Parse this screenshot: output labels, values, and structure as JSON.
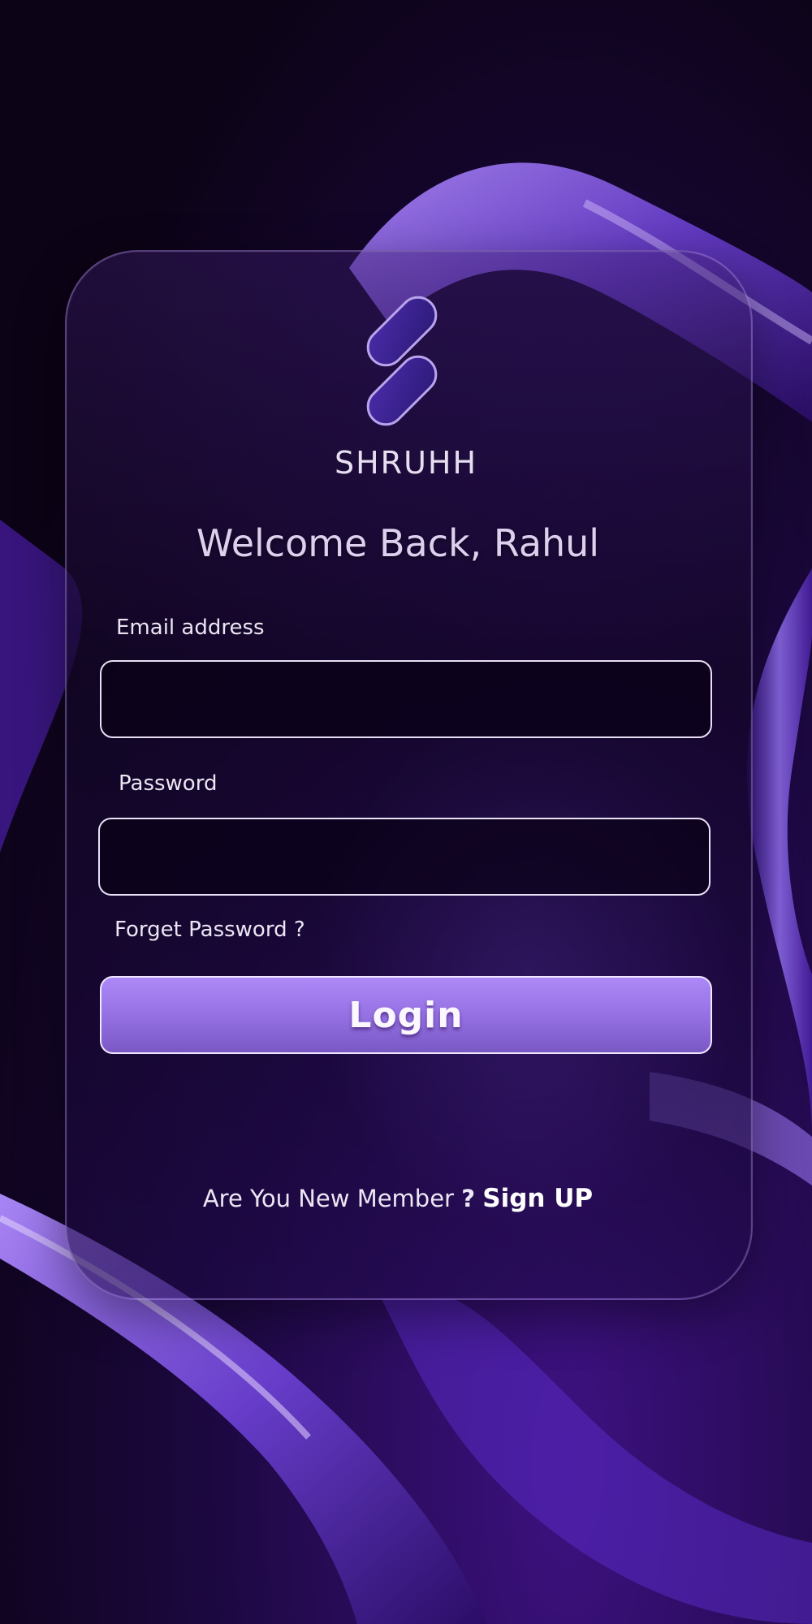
{
  "brand": {
    "name": "SHRUHH",
    "logo_icon": "brand-logo-icon"
  },
  "header": {
    "welcome_text": "Welcome Back, Rahul"
  },
  "form": {
    "email_label": "Email address",
    "email_value": "",
    "password_label": "Password",
    "password_value": "",
    "forgot_password": "Forget Password ?",
    "login_label": "Login"
  },
  "footer": {
    "new_member_text": "Are You New Member",
    "question_mark": "?",
    "signup_label": "Sign UP"
  },
  "colors": {
    "background": "#0c0316",
    "accent": "#9571e4",
    "text": "#ece6f4"
  }
}
